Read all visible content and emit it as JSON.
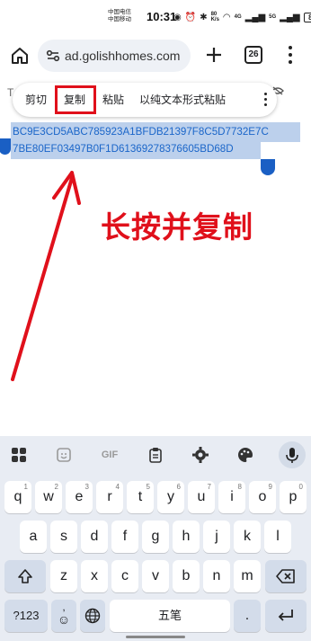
{
  "status_bar": {
    "carrier_line1": "中国电信",
    "carrier_line2": "中国移动",
    "time": "10:31",
    "network_top": "80",
    "network_bottom": "K/s",
    "signal1": "4G",
    "signal2": "5G",
    "battery": "87"
  },
  "browser": {
    "url": "ad.golishhomes.com",
    "tab_count": "26"
  },
  "context_menu": {
    "cut": "剪切",
    "copy": "复制",
    "paste": "粘贴",
    "paste_plain": "以纯文本形式粘贴"
  },
  "selection": {
    "line1": "BC9E3CD5ABC785923A1BFDB21397F8C5D7732E7C",
    "line2": "7BE80EF03497B0F1D61369278376605BD68D"
  },
  "annotation": {
    "text": "长按并复制",
    "color": "#e0101b"
  },
  "keyboard": {
    "toolbar": [
      "apps-grid-icon",
      "sticker-icon",
      "GIF",
      "clipboard-icon",
      "gear-icon",
      "palette-icon",
      "mic-icon"
    ],
    "gif_label": "GIF",
    "row1": [
      {
        "key": "q",
        "hint": "1"
      },
      {
        "key": "w",
        "hint": "2"
      },
      {
        "key": "e",
        "hint": "3"
      },
      {
        "key": "r",
        "hint": "4"
      },
      {
        "key": "t",
        "hint": "5"
      },
      {
        "key": "y",
        "hint": "6"
      },
      {
        "key": "u",
        "hint": "7"
      },
      {
        "key": "i",
        "hint": "8"
      },
      {
        "key": "o",
        "hint": "9"
      },
      {
        "key": "p",
        "hint": "0"
      }
    ],
    "row2": [
      "a",
      "s",
      "d",
      "f",
      "g",
      "h",
      "j",
      "k",
      "l"
    ],
    "row3": [
      "z",
      "x",
      "c",
      "v",
      "b",
      "n",
      "m"
    ],
    "symbols": "?123",
    "emoji_top": ",",
    "space": "五笔",
    "period": "."
  },
  "colors": {
    "selection_bg": "#bcd0ec",
    "selection_text": "#1b66c9",
    "handle": "#1a5fc4",
    "highlight_box": "#e0101b",
    "keyboard_bg": "#e8ecf3"
  }
}
